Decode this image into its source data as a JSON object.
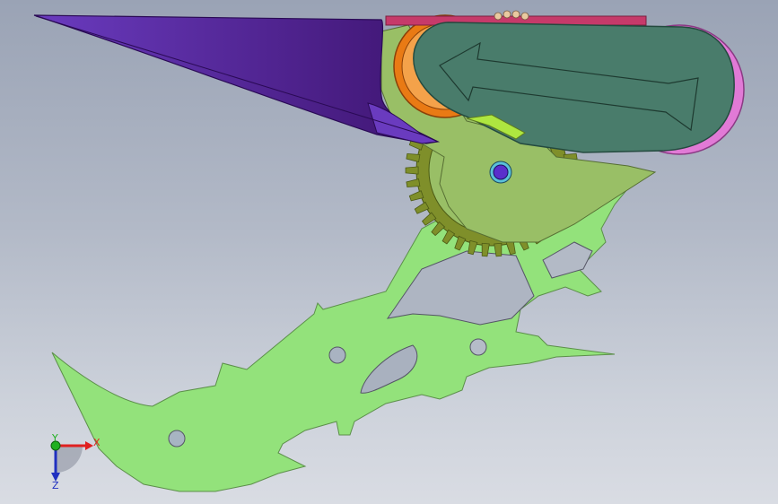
{
  "viewport": {
    "background_top": "#9aa3b5",
    "background_bottom": "#d9dce3"
  },
  "triad": {
    "x_label": "X",
    "y_label": "Y",
    "z_label": "Z",
    "x_color": "#e02020",
    "y_color": "#20b020",
    "z_color": "#2030c0"
  },
  "parts": {
    "frame_color": "#93e27b",
    "gear_color": "#7f8f2a",
    "rotor_color": "#99bf66",
    "blade_color": "#4a1a8a",
    "knob_color": "#497c6b",
    "pink_ring_color": "#e17ad6",
    "orange_ring_color": "#e97a14",
    "pin_color": "#5a2ecc"
  }
}
